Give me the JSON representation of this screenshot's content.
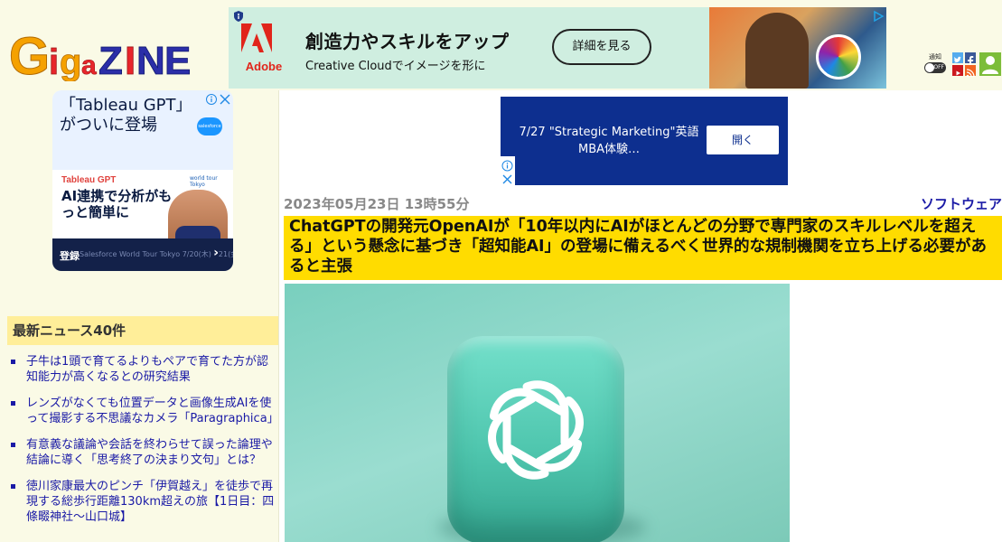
{
  "site": {
    "logo_text": "Gigazine"
  },
  "top_ad": {
    "brand": "Adobe",
    "headline": "創造力やスキルをアップ",
    "subline": "Creative Cloudでイメージを形に",
    "cta": "詳細を見る"
  },
  "header_icons": {
    "notify_label": "通知",
    "notify_state": "OFF"
  },
  "side_ad": {
    "headline": "「Tableau GPT」がついに登場",
    "brand_badge": "salesforce",
    "product": "Tableau GPT",
    "tagline": "AI連携で分析がもっと簡単に",
    "event": "world tour Tokyo",
    "login": "登録",
    "faded_footer": "Salesforce World Tour Tokyo  7/20(木)・21(金)"
  },
  "sidebar": {
    "heading": "最新ニュース40件",
    "news": [
      "子牛は1頭で育てるよりもペアで育てた方が認知能力が高くなるとの研究結果",
      "レンズがなくても位置データと画像生成AIを使って撮影する不思議なカメラ「Paragraphica」",
      "有意義な議論や会話を終わらせて誤った論理や結論に導く「思考終了の決まり文句」とは？",
      "徳川家康最大のピンチ「伊賀越え」を徒歩で再現する総歩行距離130km超えの旅【1日目：四條畷神社〜山口城】"
    ]
  },
  "mid_ad": {
    "text": "7/27 \"Strategic Marketing\"英語MBA体験…",
    "button": "開く"
  },
  "article": {
    "date": "2023年05月23日 13時55分",
    "category": "ソフトウェア",
    "title": "ChatGPTの開発元OpenAIが「10年以内にAIがほとんどの分野で専門家のスキルレベルを超える」という懸念に基づき「超知能AI」の登場に備えるべく世界的な規制機関を立ち上げる必要があると主張"
  },
  "colors": {
    "page_bg": "#fafae6",
    "title_highlight": "#ffdc00",
    "link": "#1a1aa6",
    "sidebar_heading_bg": "#ffee99",
    "hero_bg": "#8fd6c6"
  }
}
